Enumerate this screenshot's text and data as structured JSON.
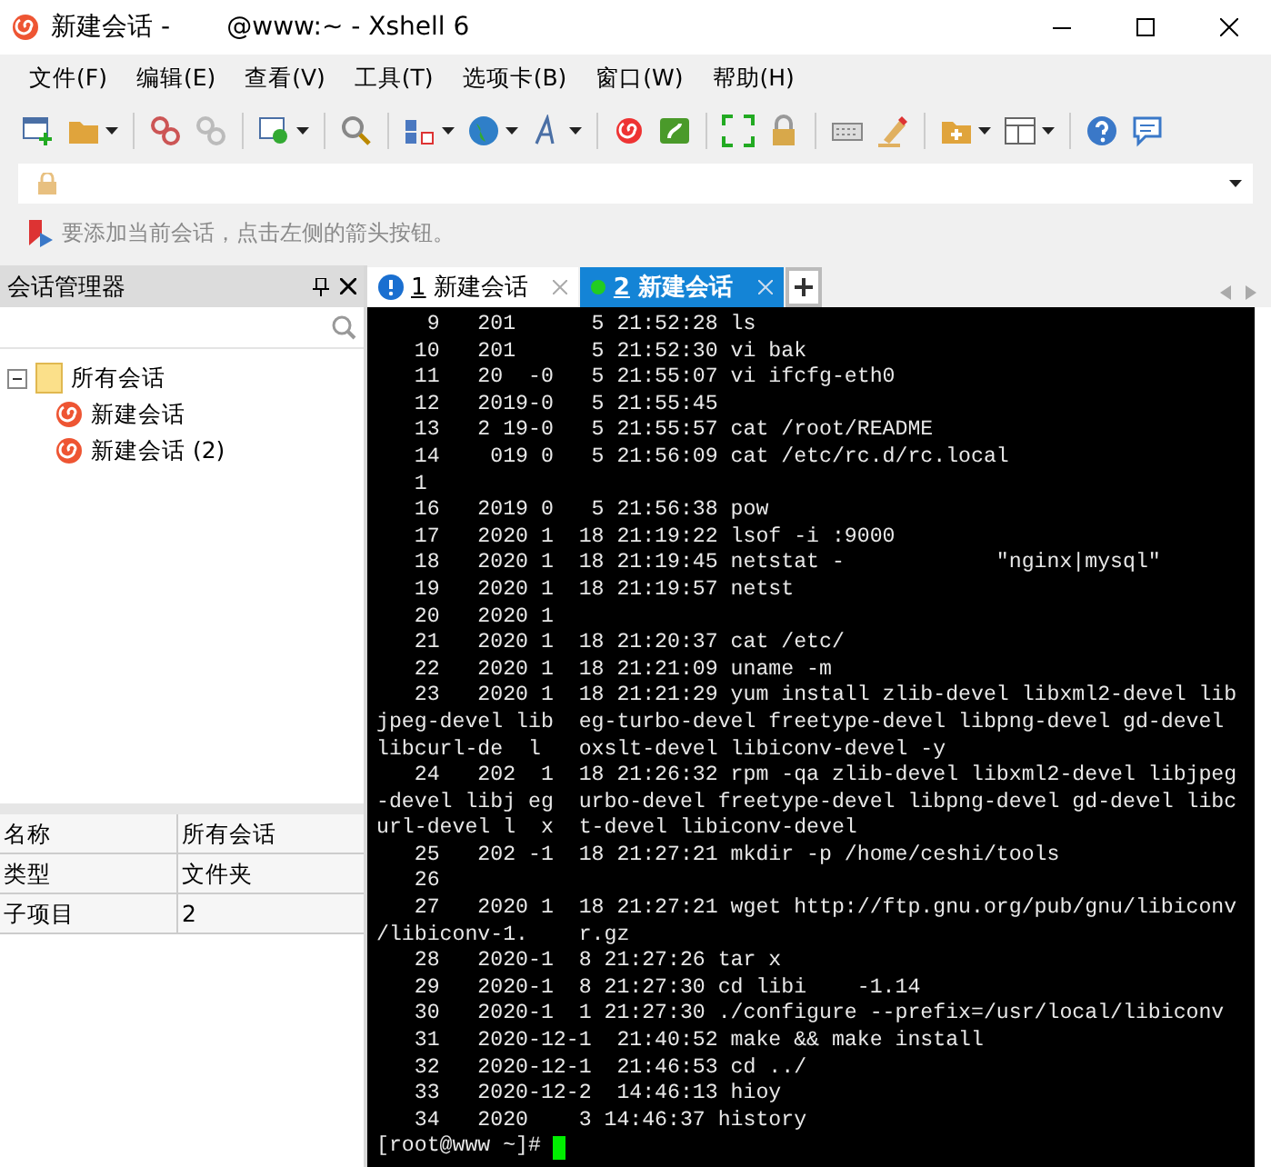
{
  "window": {
    "title": "新建会话 -       @www:~ - Xshell 6"
  },
  "menu": [
    "文件(F)",
    "编辑(E)",
    "查看(V)",
    "工具(T)",
    "选项卡(B)",
    "窗口(W)",
    "帮助(H)"
  ],
  "hint": "要添加当前会话，点击左侧的箭头按钮。",
  "session_manager": {
    "title": "会话管理器",
    "tree": [
      {
        "label": "所有会话",
        "expanded": true,
        "children": [
          {
            "label": "新建会话"
          },
          {
            "label": "新建会话 (2)"
          }
        ]
      }
    ],
    "properties": [
      {
        "name": "名称",
        "value": "所有会话"
      },
      {
        "name": "类型",
        "value": "文件夹"
      },
      {
        "name": "子项目",
        "value": "2"
      }
    ]
  },
  "tabs": [
    {
      "number": "1",
      "label": "新建会话",
      "kind": "warning",
      "selected": false
    },
    {
      "number": "2",
      "label": "新建会话",
      "kind": "connected",
      "selected": true
    }
  ],
  "terminal": {
    "lines": [
      "    9   201      5 21:52:28 ls",
      "   10   201      5 21:52:30 vi bak",
      "   11   20  -0   5 21:55:07 vi ifcfg-eth0",
      "   12   2019-0   5 21:55:45",
      "   13   2 19-0   5 21:55:57 cat /root/README",
      "   14    019 0   5 21:56:09 cat /etc/rc.d/rc.local",
      "   1",
      "   16   2019 0   5 21:56:38 pow",
      "   17   2020 1  18 21:19:22 lsof -i :9000",
      "   18   2020 1  18 21:19:45 netstat -            \"nginx|mysql\"",
      "   19   2020 1  18 21:19:57 netst",
      "   20   2020 1",
      "   21   2020 1  18 21:20:37 cat /etc/",
      "   22   2020 1  18 21:21:09 uname -m",
      "   23   2020 1  18 21:21:29 yum install zlib-devel libxml2-devel lib",
      "jpeg-devel lib  eg-turbo-devel freetype-devel libpng-devel gd-devel",
      "libcurl-de  l   oxslt-devel libiconv-devel -y",
      "   24   202  1  18 21:26:32 rpm -qa zlib-devel libxml2-devel libjpeg",
      "-devel libj eg  urbo-devel freetype-devel libpng-devel gd-devel libc",
      "url-devel l  x  t-devel libiconv-devel",
      "   25   202 -1  18 21:27:21 mkdir -p /home/ceshi/tools",
      "   26",
      "   27   2020 1  18 21:27:21 wget http://ftp.gnu.org/pub/gnu/libiconv",
      "/libiconv-1.    r.gz",
      "   28   2020-1  8 21:27:26 tar x",
      "   29   2020-1  8 21:27:30 cd libi    -1.14",
      "   30   2020-1  1 21:27:30 ./configure --prefix=/usr/local/libiconv",
      "   31   2020-12-1  21:40:52 make && make install",
      "   32   2020-12-1  21:46:53 cd ../",
      "   33   2020-12-2  14:46:13 hioy",
      "   34   2020    3 14:46:37 history"
    ],
    "prompt": "[root@www ~]#"
  }
}
